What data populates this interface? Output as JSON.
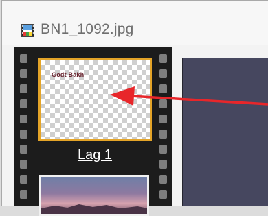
{
  "window": {
    "title": "BN1_1092.jpg",
    "app_icon": "film-image-icon"
  },
  "layers": [
    {
      "label": "Lag 1",
      "thumbnail_text": "Godt Bakh",
      "selected": true,
      "highlight_color": "#e4a428"
    },
    {
      "label": "",
      "thumbnail": "sunset-photo"
    }
  ],
  "annotation": {
    "type": "red-arrow",
    "color": "#e8262a"
  },
  "canvas": {
    "background": "#46475f"
  }
}
